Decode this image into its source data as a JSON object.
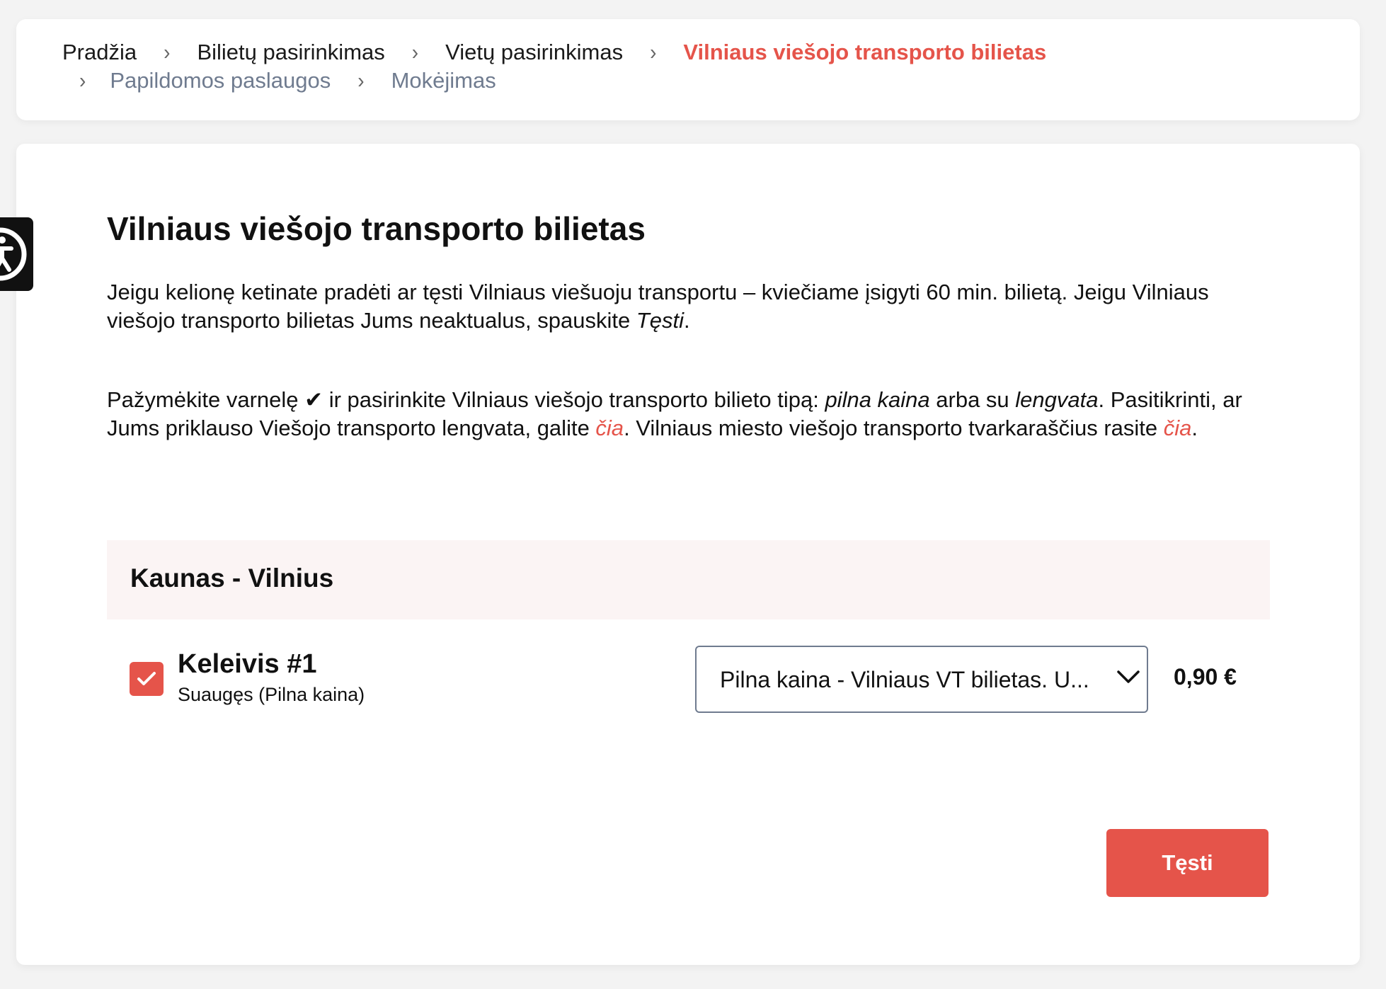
{
  "breadcrumb": {
    "items": [
      {
        "label": "Pradžia",
        "state": "done"
      },
      {
        "label": "Bilietų pasirinkimas",
        "state": "done"
      },
      {
        "label": "Vietų pasirinkimas",
        "state": "done"
      },
      {
        "label": "Vilniaus viešojo transporto bilietas",
        "state": "current"
      },
      {
        "label": "Papildomos paslaugos",
        "state": "upcoming"
      },
      {
        "label": "Mokėjimas",
        "state": "upcoming"
      }
    ],
    "separator": "›"
  },
  "accessibility_button": {
    "icon": "accessibility-icon"
  },
  "page": {
    "title": "Vilniaus viešojo transporto bilietas",
    "intro": {
      "part1": "Jeigu kelionę ketinate pradėti ar tęsti Vilniaus viešuoju transportu – kviečiame įsigyti 60 min. bilietą. Jeigu Vilniaus viešojo transporto bilietas Jums neaktualus, spauskite ",
      "emphasis": "Tęsti",
      "part2": "."
    },
    "instructions": {
      "part1": "Pažymėkite varnelę ✔ ir pasirinkite Vilniaus viešojo transporto bilieto tipą: ",
      "em1": "pilna kaina",
      "part2": " arba su ",
      "em2": "lengvata",
      "part3": ". Pasitikrinti, ar Jums priklauso Viešojo transporto lengvata, galite ",
      "link1": "čia",
      "part4": ". Vilniaus miesto viešojo transporto tvarkaraščius rasite ",
      "link2": "čia",
      "part5": "."
    }
  },
  "trip": {
    "route": "Kaunas - Vilnius",
    "passengers": [
      {
        "name": "Keleivis #1",
        "type": "Suaugęs (Pilna kaina)",
        "checked": true,
        "ticket_option": "Pilna kaina - Vilniaus VT bilietas. U...",
        "price": "0,90 €"
      }
    ]
  },
  "actions": {
    "continue_label": "Tęsti"
  },
  "colors": {
    "accent": "#e5544a",
    "muted": "#6f7b8f",
    "route_bg": "#fbf4f4",
    "page_bg": "#f3f3f3"
  }
}
